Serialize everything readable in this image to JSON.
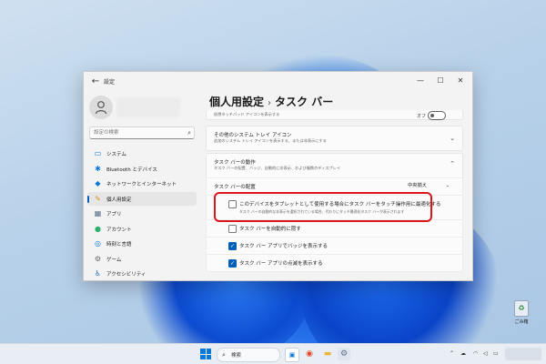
{
  "window": {
    "app_title": "設定",
    "breadcrumb_parent": "個人用設定",
    "breadcrumb_separator": "›",
    "breadcrumb_current": "タスク バー"
  },
  "sidebar": {
    "search_placeholder": "設定の検索",
    "items": [
      {
        "label": "システム",
        "icon": "monitor-icon",
        "color": "#0a78d8"
      },
      {
        "label": "Bluetooth とデバイス",
        "icon": "bluetooth-icon",
        "color": "#0a78d8"
      },
      {
        "label": "ネットワークとインターネット",
        "icon": "wifi-icon",
        "color": "#0a78d8"
      },
      {
        "label": "個人用設定",
        "icon": "brush-icon",
        "color": "#e08a2a",
        "selected": true
      },
      {
        "label": "アプリ",
        "icon": "apps-icon",
        "color": "#5a6e88"
      },
      {
        "label": "アカウント",
        "icon": "person-icon",
        "color": "#2fae6b"
      },
      {
        "label": "時刻と言語",
        "icon": "globe-clock-icon",
        "color": "#0a78d8"
      },
      {
        "label": "ゲーム",
        "icon": "gamepad-icon",
        "color": "#6b6b6b"
      },
      {
        "label": "アクセシビリティ",
        "icon": "accessibility-icon",
        "color": "#1b6fd0"
      }
    ]
  },
  "content": {
    "touchpad_row": {
      "text": "仮想タッチパッド アイコンを表示する",
      "toggle_label": "オフ"
    },
    "other_tray": {
      "title": "その他のシステム トレイ アイコン",
      "subtitle": "追加のシステム トレイ アイコンを表示する、または非表示にする"
    },
    "behavior": {
      "title": "タスク バーの動作",
      "subtitle": "タスク バーの配置、バッジ、自動的に非表示、および複数のディスプレイ"
    },
    "alignment": {
      "label": "タスク バーの配置",
      "value": "中央揃え"
    },
    "tablet_opt": {
      "label": "このデバイスをタブレットとして使用する場合にタスク バーをタッチ操作用に最適化する",
      "desc": "タスク バーの自動的な非表示を選択されている場合、代わりにタッチ最適化タスク バーが表示されます",
      "checked": false
    },
    "auto_hide": {
      "label": "タスク バーを自動的に隠す",
      "checked": false
    },
    "badges": {
      "label": "タスク バー アプリでバッジを表示する",
      "checked": true
    },
    "flashing": {
      "label": "タスク バー アプリの点滅を表示する",
      "checked": true
    }
  },
  "desktop": {
    "recycle_bin_label": "ごみ箱"
  },
  "taskbar": {
    "search_label": "検索"
  },
  "colors": {
    "accent": "#005fb8",
    "highlight": "#d9161c"
  }
}
